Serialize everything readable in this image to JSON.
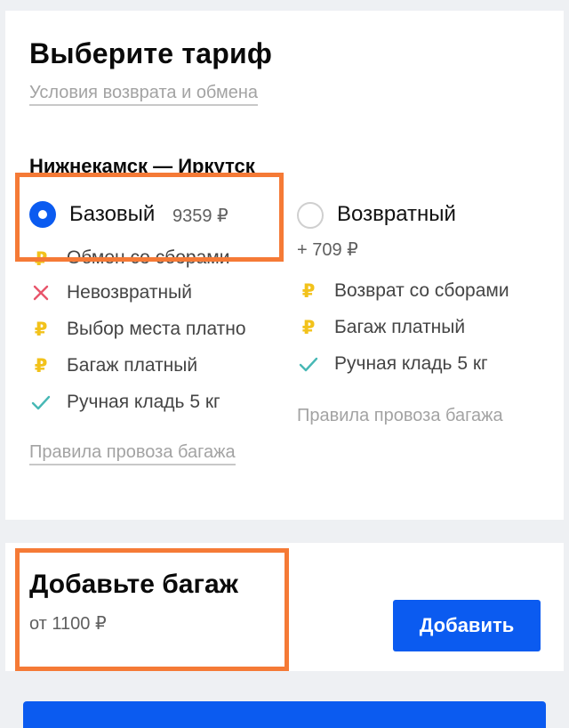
{
  "tariff_section": {
    "title": "Выберите тариф",
    "refund_link": "Условия возврата и обмена",
    "route": "Нижнекамск — Иркутск",
    "options": [
      {
        "name": "Базовый",
        "price": "9359 ₽",
        "selected": true,
        "features": [
          {
            "icon": "ruble-icon",
            "text": "Обмен со сборами"
          },
          {
            "icon": "cross-icon",
            "text": "Невозвратный"
          },
          {
            "icon": "ruble-icon",
            "text": "Выбор места платно"
          },
          {
            "icon": "ruble-icon",
            "text": "Багаж платный"
          },
          {
            "icon": "check-icon",
            "text": "Ручная кладь 5 кг"
          }
        ],
        "rules_link": "Правила провоза багажа"
      },
      {
        "name": "Возвратный",
        "price": "+ 709 ₽",
        "selected": false,
        "features": [
          {
            "icon": "ruble-icon",
            "text": "Возврат со сборами"
          },
          {
            "icon": "ruble-icon",
            "text": "Багаж платный"
          },
          {
            "icon": "check-icon",
            "text": "Ручная кладь 5 кг"
          }
        ],
        "rules_link": "Правила провоза багажа"
      }
    ]
  },
  "baggage_section": {
    "title": "Добавьте багаж",
    "price": "от 1100 ₽",
    "add_button": "Добавить"
  },
  "colors": {
    "accent": "#0b5bf0",
    "highlight": "#f57a36",
    "ruble": "#f2c21b",
    "cross": "#e8556b",
    "check": "#47b8b5"
  }
}
